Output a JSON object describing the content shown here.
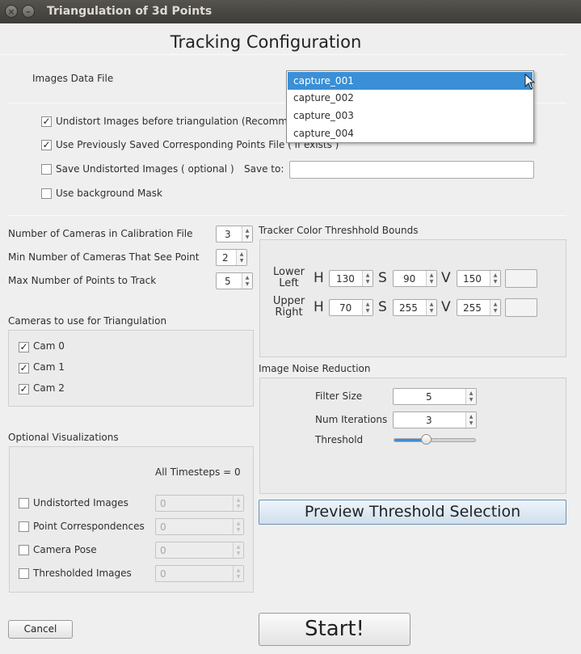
{
  "window": {
    "title": "Triangulation of 3d Points"
  },
  "heading": "Tracking Configuration",
  "images_data_file": {
    "label": "Images Data File",
    "options": [
      "capture_001",
      "capture_002",
      "capture_003",
      "capture_004"
    ],
    "selected": "capture_001"
  },
  "options": {
    "undistort": {
      "label": "Undistort Images before triangulation (Recomm",
      "checked": true
    },
    "use_saved": {
      "label": "Use Previously Saved Corresponding Points File ( if exists )",
      "checked": true
    },
    "save_undistorted": {
      "label": "Save Undistorted Images ( optional )",
      "checked": false
    },
    "save_to_label": "Save to:",
    "save_to_value": "",
    "bg_mask": {
      "label": "Use background Mask",
      "checked": false
    }
  },
  "camera_settings": {
    "num_cameras": {
      "label": "Number of Cameras in Calibration File",
      "value": "3"
    },
    "min_cameras": {
      "label": "Min Number of Cameras That See Point",
      "value": "2"
    },
    "max_points": {
      "label": "Max Number of Points to Track",
      "value": "5"
    }
  },
  "cameras": {
    "title": "Cameras to use for Triangulation",
    "items": [
      {
        "label": "Cam 0",
        "checked": true
      },
      {
        "label": "Cam 1",
        "checked": true
      },
      {
        "label": "Cam 2",
        "checked": true
      }
    ]
  },
  "visualizations": {
    "title": "Optional Visualizations",
    "all_timesteps": "All Timesteps = 0",
    "items": [
      {
        "label": "Undistorted Images",
        "value": "0",
        "checked": false
      },
      {
        "label": "Point Correspondences",
        "value": "0",
        "checked": false
      },
      {
        "label": "Camera Pose",
        "value": "0",
        "checked": false
      },
      {
        "label": "Thresholded Images",
        "value": "0",
        "checked": false
      }
    ]
  },
  "color_bounds": {
    "title": "Tracker Color Threshhold Bounds",
    "lower": {
      "label_line1": "Lower",
      "label_line2": "Left",
      "h": "130",
      "s": "90",
      "v": "150"
    },
    "upper": {
      "label_line1": "Upper",
      "label_line2": "Right",
      "h": "70",
      "s": "255",
      "v": "255"
    },
    "h_label": "H",
    "s_label": "S",
    "v_label": "V"
  },
  "noise": {
    "title": "Image Noise Reduction",
    "filter_size": {
      "label": "Filter Size",
      "value": "5"
    },
    "num_iterations": {
      "label": "Num Iterations",
      "value": "3"
    },
    "threshold": {
      "label": "Threshold",
      "level": 0.4
    }
  },
  "buttons": {
    "preview": "Preview Threshold Selection",
    "cancel": "Cancel",
    "start": "Start!"
  },
  "colors": {
    "selection": "#3a8fd6",
    "slider_fill": "#3a8fd6"
  }
}
